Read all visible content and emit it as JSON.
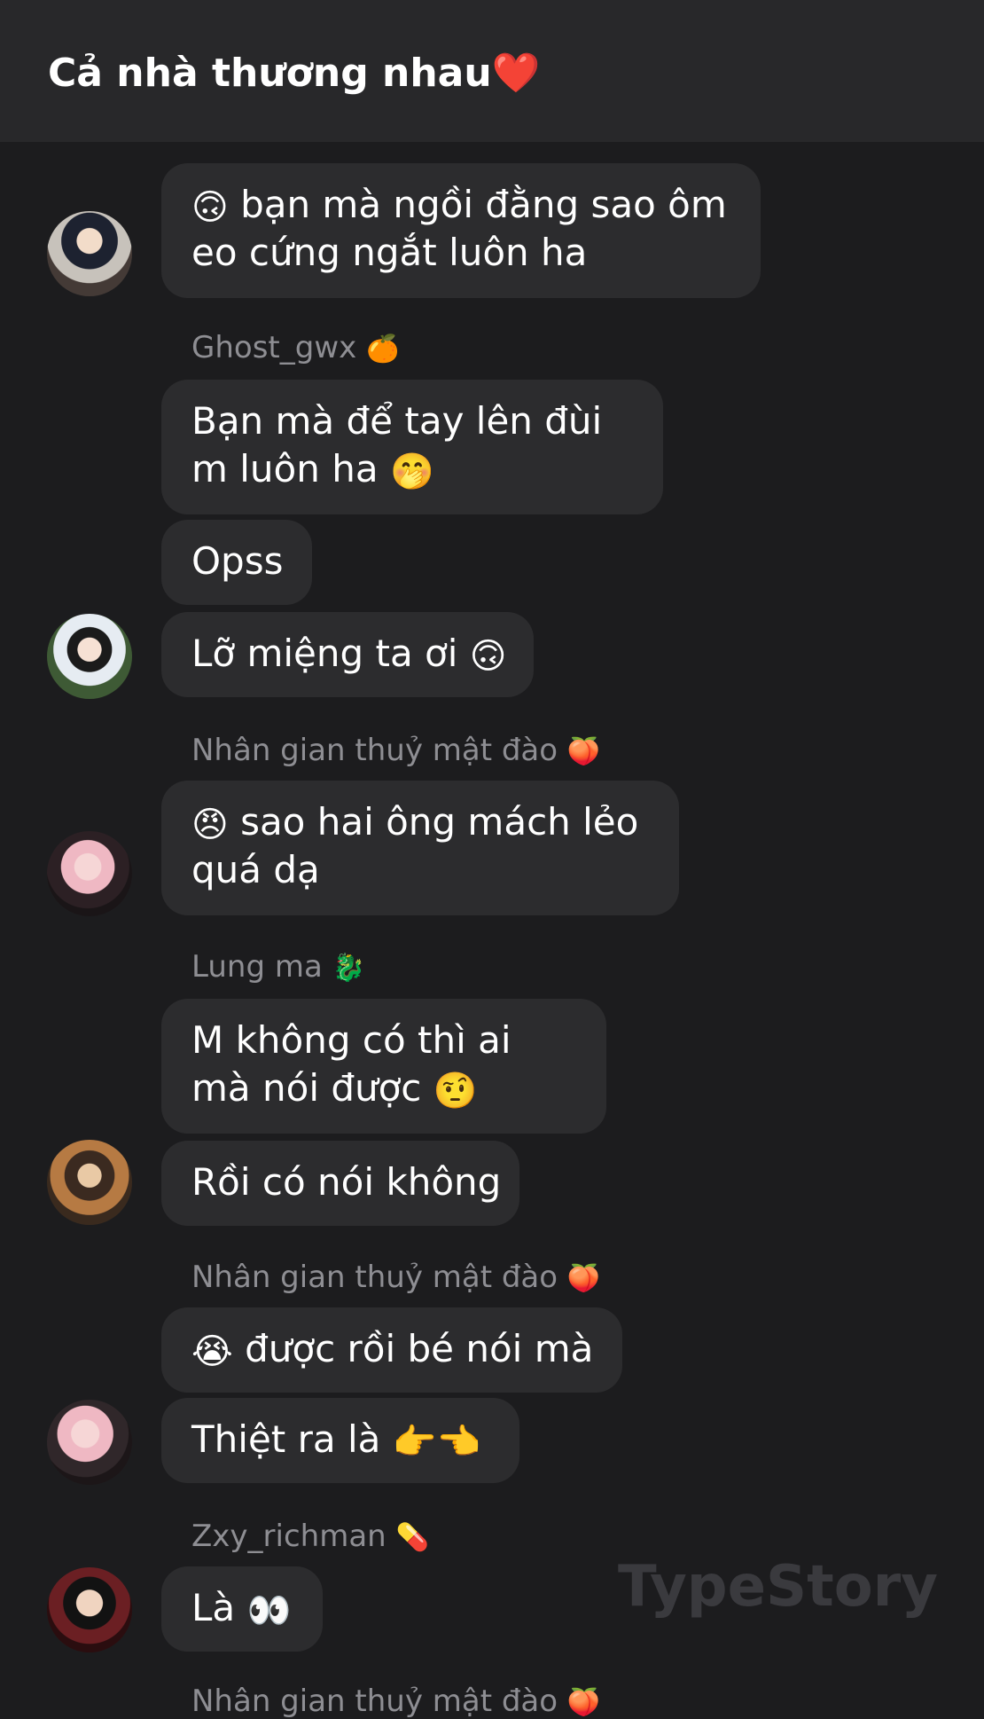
{
  "header": {
    "title": "Cả nhà thương nhau❤️"
  },
  "messages": [
    {
      "sender": "Ghost_gwx",
      "sender_emoji": "🍊",
      "text": "Bạn mà để tay lên đùi m luôn ha",
      "text_emoji": "🤭"
    },
    {
      "text": "Opss"
    },
    {
      "text": "Lỡ miệng ta ơi",
      "text_emoji": "🙃"
    },
    {
      "sender": "Nhân gian thuỷ mật đào",
      "sender_emoji": "🍑",
      "text": "sao hai ông mách lẻo quá dạ",
      "lead_emoji": "😠"
    },
    {
      "sender": "Lung ma",
      "sender_emoji": "🐉",
      "text": "M không có thì ai mà nói được",
      "text_emoji": "🤨"
    },
    {
      "text": "Rồi có nói không"
    },
    {
      "sender": "Nhân gian thuỷ mật đào",
      "sender_emoji": "🍑",
      "text": "được rồi bé nói mà",
      "lead_emoji": "😭"
    },
    {
      "text": "Thiệt ra là",
      "text_emoji": "👉👈"
    },
    {
      "sender": "Zxy_richman",
      "sender_emoji": "💊",
      "text": "Là",
      "text_emoji": "👀"
    },
    {
      "sender": "Nhân gian thuỷ mật đào",
      "sender_emoji": "🍑"
    }
  ],
  "top_partial": {
    "text": "bạn mà ngồi đằng sao ôm eo cứng ngắt luôn ha",
    "lead_emoji": "🙃"
  },
  "watermark": "TypeStory"
}
